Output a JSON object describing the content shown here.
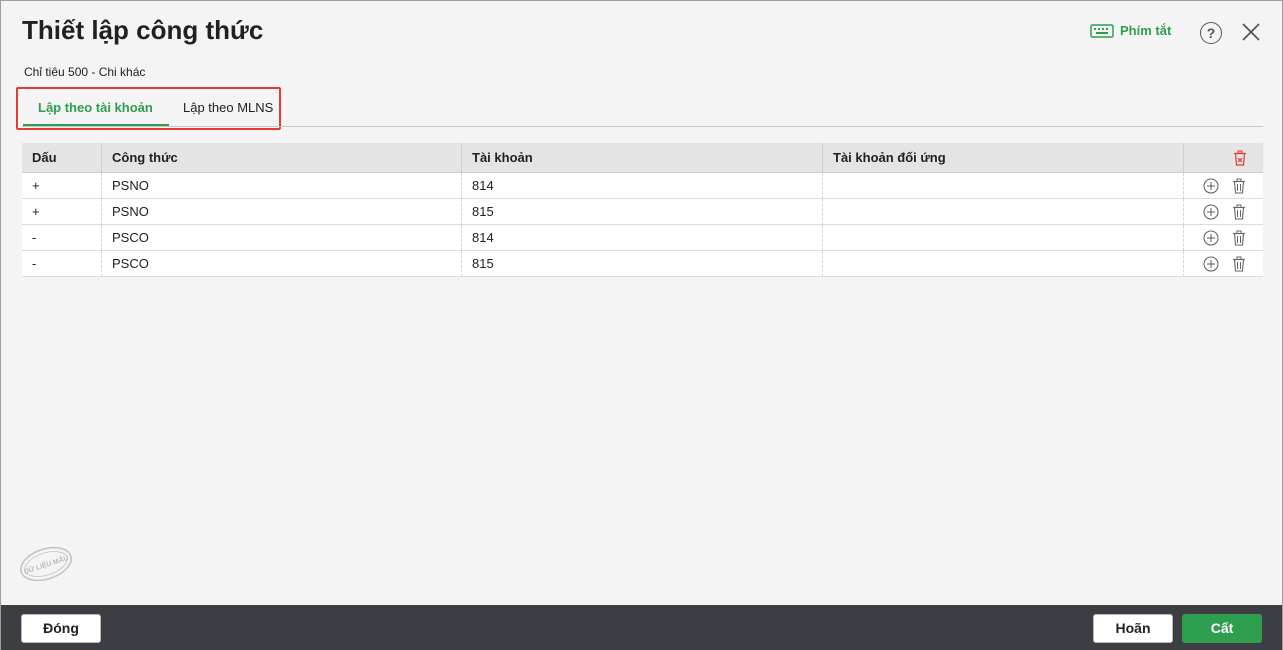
{
  "dialog": {
    "title": "Thiết lập công thức",
    "subtitle": "Chỉ tiêu 500 - Chi khác",
    "shortcut_label": "Phím tắt",
    "help_label": "?"
  },
  "tabs": [
    {
      "label": "Lập theo tài khoản",
      "active": true
    },
    {
      "label": "Lập theo MLNS",
      "active": false
    }
  ],
  "grid": {
    "columns": [
      "Dấu",
      "Công thức",
      "Tài khoản",
      "Tài khoản đối ứng"
    ],
    "rows": [
      {
        "sign": "+",
        "formula": "PSNO",
        "account": "814",
        "contra_account": ""
      },
      {
        "sign": "+",
        "formula": "PSNO",
        "account": "815",
        "contra_account": ""
      },
      {
        "sign": "-",
        "formula": "PSCO",
        "account": "814",
        "contra_account": ""
      },
      {
        "sign": "-",
        "formula": "PSCO",
        "account": "815",
        "contra_account": ""
      }
    ]
  },
  "watermark": {
    "text": "DỮ LIỆU MẪU"
  },
  "footer": {
    "close_label": "Đóng",
    "cancel_label": "Hoãn",
    "save_label": "Cất"
  },
  "colors": {
    "accent": "#2e9e4f",
    "highlight_border": "#e53935",
    "footer_bg": "#3c3e44"
  }
}
